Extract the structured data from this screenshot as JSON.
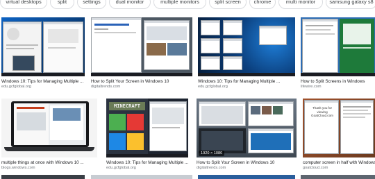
{
  "chips": [
    {
      "label": "virtual desktops"
    },
    {
      "label": "split"
    },
    {
      "label": "settings"
    },
    {
      "label": "dual monitor"
    },
    {
      "label": "multiple monitors"
    },
    {
      "label": "split screen"
    },
    {
      "label": "chrome"
    },
    {
      "label": "multi monitor"
    },
    {
      "label": "samsung galaxy s8"
    }
  ],
  "results": [
    {
      "caption": "Windows 10: Tips for Managing Multiple ...",
      "source": "edu.gcfglobal.org"
    },
    {
      "caption": "How to Split Your Screen in Windows 10",
      "source": "digitaltrends.com"
    },
    {
      "caption": "Windows 10: Tips for Managing Multiple ...",
      "source": "edu.gcfglobal.org"
    },
    {
      "caption": "How to Split Screens in Windows",
      "source": "lifewire.com"
    },
    {
      "caption": "multiple things at once with Windows 10 ...",
      "source": "blogs.windows.com"
    },
    {
      "caption": "Windows 10: Tips for Managing Multiple ...",
      "source": "edu.gcfglobal.org",
      "thumb_text": "MINECRAFT"
    },
    {
      "caption": "How to Split Your Screen in Windows 10",
      "source": "digitaltrends.com",
      "badge": "1920 × 1080"
    },
    {
      "caption": "computer screen in half with Windows",
      "source": "goatcloud.com",
      "thumb_text": "Thank you for viewing GoatCloud.com"
    }
  ],
  "colors": {
    "win_blue": "#0b5cad",
    "laptop_dark": "#17181b",
    "green_window": "#1e7a3a",
    "chip_border": "#dadce0"
  }
}
